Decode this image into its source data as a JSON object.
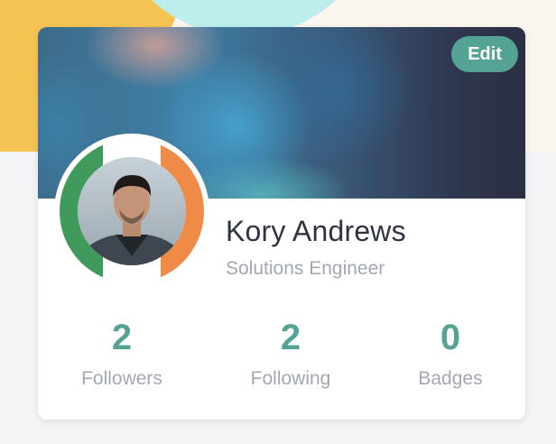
{
  "profile": {
    "name": "Kory Andrews",
    "title": "Solutions Engineer",
    "edit_label": "Edit"
  },
  "stats": [
    {
      "value": "2",
      "label": "Followers"
    },
    {
      "value": "2",
      "label": "Following"
    },
    {
      "value": "0",
      "label": "Badges"
    }
  ],
  "colors": {
    "accent": "#55a394",
    "name_text": "#2e3442",
    "muted_text": "#a1a7b3",
    "ring_left": "#3f9a5c",
    "ring_right": "#f08a47",
    "banner_dark": "#2b2f42"
  }
}
